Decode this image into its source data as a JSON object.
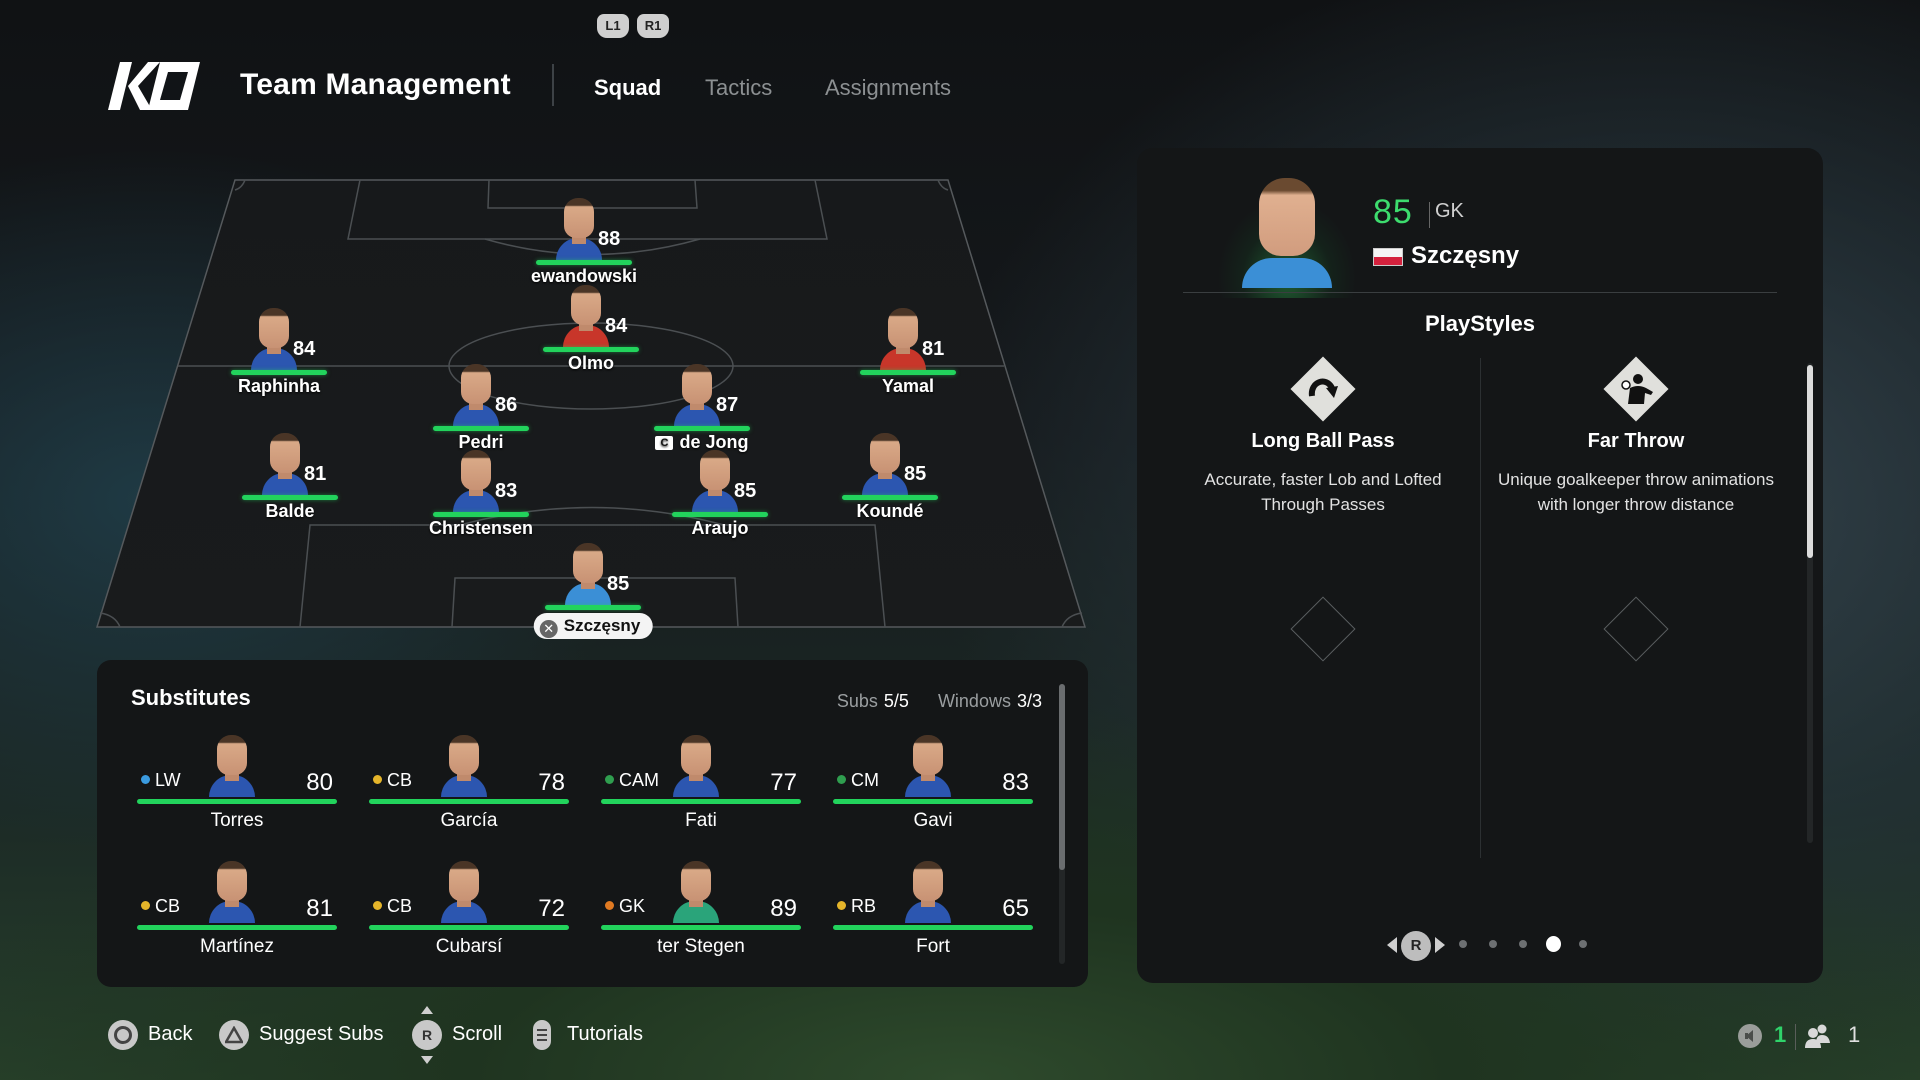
{
  "header": {
    "shoulder_left": "L1",
    "shoulder_right": "R1",
    "logo": "KO",
    "title": "Team Management",
    "tabs": [
      {
        "label": "Squad",
        "active": true
      },
      {
        "label": "Tactics",
        "active": false
      },
      {
        "label": "Assignments",
        "active": false
      }
    ]
  },
  "lineup": [
    {
      "name": "ewandowski",
      "rating": 88,
      "kit": "blue"
    },
    {
      "name": "Olmo",
      "rating": 84,
      "kit": "red"
    },
    {
      "name": "Raphinha",
      "rating": 84,
      "kit": "blue"
    },
    {
      "name": "Yamal",
      "rating": 81,
      "kit": "red"
    },
    {
      "name": "Pedri",
      "rating": 86,
      "kit": "blue"
    },
    {
      "name": "de Jong",
      "rating": 87,
      "kit": "blue",
      "captain": "C"
    },
    {
      "name": "Balde",
      "rating": 81,
      "kit": "blue"
    },
    {
      "name": "Christensen",
      "rating": 83,
      "kit": "blue"
    },
    {
      "name": "Araujo",
      "rating": 85,
      "kit": "blue"
    },
    {
      "name": "Koundé",
      "rating": 85,
      "kit": "blue"
    },
    {
      "name": "Szczęsny",
      "rating": 85,
      "kit": "lightblue",
      "selected": true
    }
  ],
  "substitutes": {
    "title": "Substitutes",
    "subs_label": "Subs",
    "subs_value": "5/5",
    "windows_label": "Windows",
    "windows_value": "3/3",
    "players": [
      {
        "position": "LW",
        "dot_color": "#3b9be0",
        "rating": 80,
        "name": "Torres"
      },
      {
        "position": "CB",
        "dot_color": "#e5b52a",
        "rating": 78,
        "name": "García"
      },
      {
        "position": "CAM",
        "dot_color": "#2f9e4f",
        "rating": 77,
        "name": "Fati"
      },
      {
        "position": "CM",
        "dot_color": "#2f9e4f",
        "rating": 83,
        "name": "Gavi"
      },
      {
        "position": "CB",
        "dot_color": "#e5b52a",
        "rating": 81,
        "name": "Martínez"
      },
      {
        "position": "CB",
        "dot_color": "#e5b52a",
        "rating": 72,
        "name": "Cubarsí"
      },
      {
        "position": "GK",
        "dot_color": "#e07a22",
        "rating": 89,
        "name": "ter Stegen"
      },
      {
        "position": "RB",
        "dot_color": "#e5b52a",
        "rating": 65,
        "name": "Fort"
      }
    ]
  },
  "player_card": {
    "rating": "85",
    "position": "GK",
    "nation": "Poland",
    "name": "Szczęsny",
    "playstyles_title": "PlayStyles",
    "playstyles": [
      {
        "icon": "long-ball-pass-icon",
        "name": "Long Ball Pass",
        "description": "Accurate, faster Lob and Lofted Through Passes"
      },
      {
        "icon": "far-throw-icon",
        "name": "Far Throw",
        "description": "Unique goalkeeper throw animations with longer throw distance"
      }
    ],
    "pager": {
      "button": "R",
      "pages": 5,
      "active_page": 4
    }
  },
  "footer": {
    "actions": [
      {
        "icon": "circle-button-icon",
        "label": "Back"
      },
      {
        "icon": "triangle-button-icon",
        "label": "Suggest Subs"
      },
      {
        "icon": "right-stick-icon",
        "glyph": "R",
        "label": "Scroll"
      },
      {
        "icon": "options-button-icon",
        "label": "Tutorials"
      }
    ],
    "status": {
      "voice_count": "1",
      "party_count": "1"
    }
  },
  "colors": {
    "accent_green": "#22d35c",
    "rating_green": "#3ddc6e",
    "panel_bg": "#141617"
  }
}
